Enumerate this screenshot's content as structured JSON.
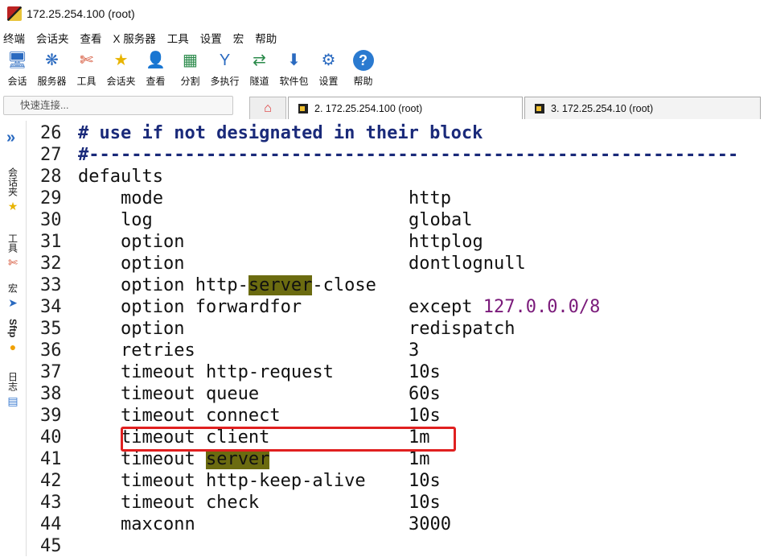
{
  "window": {
    "title": "172.25.254.100 (root)"
  },
  "menu": [
    "终端",
    "会话夹",
    "查看",
    "X 服务器",
    "工具",
    "设置",
    "宏",
    "帮助"
  ],
  "toolbar": [
    {
      "label": "会话",
      "icon": "session-icon",
      "glyph": "🖥"
    },
    {
      "label": "服务器",
      "icon": "servers-icon",
      "glyph": "❋"
    },
    {
      "label": "工具",
      "icon": "tools-icon",
      "glyph": "✄"
    },
    {
      "label": "会话夹",
      "icon": "star-icon",
      "glyph": "★"
    },
    {
      "label": "查看",
      "icon": "view-icon",
      "glyph": "👤"
    },
    {
      "label": "分割",
      "icon": "split-icon",
      "glyph": "▦"
    },
    {
      "label": "多执行",
      "icon": "multiexec-icon",
      "glyph": "Y"
    },
    {
      "label": "隧道",
      "icon": "tunnel-icon",
      "glyph": "⇄"
    },
    {
      "label": "软件包",
      "icon": "package-icon",
      "glyph": "⬇"
    },
    {
      "label": "设置",
      "icon": "settings-icon",
      "glyph": "⚙"
    },
    {
      "label": "帮助",
      "icon": "help-icon",
      "glyph": "?"
    }
  ],
  "quick_connect": {
    "placeholder": "快速连接..."
  },
  "tabs": [
    {
      "label": "2. 172.25.254.100 (root)",
      "active": true
    },
    {
      "label": "3. 172.25.254.10 (root)",
      "active": false
    }
  ],
  "sidebar": {
    "items": [
      "会话夹",
      "工具",
      "宏",
      "Sftp",
      "日志"
    ]
  },
  "lines": [
    {
      "n": "26",
      "code": "# use if not designated in their block",
      "val": ""
    },
    {
      "n": "27",
      "code": "#-------------------------------------------------------------",
      "val": ""
    },
    {
      "n": "28",
      "code": "defaults",
      "val": ""
    },
    {
      "n": "29",
      "code": "    mode",
      "val": "http"
    },
    {
      "n": "30",
      "code": "    log",
      "val": "global"
    },
    {
      "n": "31",
      "code": "    option",
      "val": "httplog"
    },
    {
      "n": "32",
      "code": "    option",
      "val": "dontlognull"
    },
    {
      "n": "33",
      "code": "    option http-server-close",
      "val": ""
    },
    {
      "n": "34",
      "code": "    option forwardfor",
      "val": "except 127.0.0.0/8"
    },
    {
      "n": "35",
      "code": "    option",
      "val": "redispatch"
    },
    {
      "n": "36",
      "code": "    retries",
      "val": "3"
    },
    {
      "n": "37",
      "code": "    timeout http-request",
      "val": "10s"
    },
    {
      "n": "38",
      "code": "    timeout queue",
      "val": "60s"
    },
    {
      "n": "39",
      "code": "    timeout connect",
      "val": "10s"
    },
    {
      "n": "40",
      "code": "    timeout client",
      "val": "1m"
    },
    {
      "n": "41",
      "code": "    timeout server",
      "val": "1m"
    },
    {
      "n": "42",
      "code": "    timeout http-keep-alive",
      "val": "10s"
    },
    {
      "n": "43",
      "code": "    timeout check",
      "val": "10s"
    },
    {
      "n": "44",
      "code": "    maxconn",
      "val": "3000"
    },
    {
      "n": "45",
      "code": "",
      "val": ""
    }
  ],
  "highlight_word": "server",
  "colors": {
    "highlight": "#6b6b10",
    "comment": "#1a2a7a",
    "number": "#7a1a7a",
    "annotation_box": "#e02020"
  }
}
